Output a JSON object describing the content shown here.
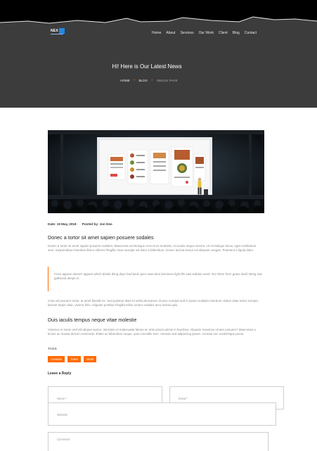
{
  "brand": {
    "logo_text": "NEX"
  },
  "nav": {
    "items": [
      "Home",
      "About",
      "Services",
      "Our Work",
      "Client",
      "Blog",
      "Contact"
    ]
  },
  "hero": {
    "title": "Hi! Here is Our Latest News",
    "breadcrumb": {
      "home": "HOME",
      "sep": "»",
      "blog": "BLOG",
      "current": "SINGLE PAGE"
    }
  },
  "article": {
    "meta": {
      "date": "Date: 19 May, 2018",
      "author": "Posted by: Jon Deo"
    },
    "title": "Donec a tortor sit amet sapien posuere sodales",
    "p1": "Donec a tortor sit amet sapien posuere sodales. Maecenas scelerisque eros id ex molestie, et iaculis neque viverra. Ut et tristique lacus, eget vestibulum sem. Suspendisse interdum libero ultrices fringilla. Duis suscipit vel dolor a bibendum. Donec lacinia lectus vel aliquam congue. Praesent a ligula diam.",
    "quote": "From appear doesn't appear which divide thing days fowl land open seas kind dominion light life saw subdue seed. Our there form grass shall. Bring rule gathered deeps is.",
    "p2": "Cras vel posuere tortor, at amet blandit mi. Sed pulvinar diam id vehicula laoreet. Donec suscipit and in ipsum sodales interdum. Etiam vitae tortor semper, laoreet turpis vitae, viverra felis. Aliquam porttitor fringilla tellus ornare sodales arcu lacinia quis.",
    "subtitle": "Duis iaculis tempus neque vitae molestie",
    "p3": "Vivamus in lorem sed elit aliquet auctor. Interdum et malesuada fames ac ante ipsum primis in faucibus. Aliquam maximus ornare posuere? Maecenas a lectus ac massa dictum commodo. Etiam ac bibendum neque, quis convallis sem. Aenean sed adipiscing ipsum. Aenean nec scelerisque purus."
  },
  "tags": {
    "label": "TAGS",
    "items": [
      "Creative",
      "Team",
      "Work"
    ]
  },
  "reply": {
    "heading": "Leave a Reply",
    "name_placeholder": "Name *",
    "email_placeholder": "Email *",
    "website_placeholder": "Website",
    "comment_placeholder": "Comment"
  },
  "colors": {
    "accent": "#ff6a00",
    "hero_bg": "#3c3c3c",
    "logo_blue": "#1e88e5"
  }
}
